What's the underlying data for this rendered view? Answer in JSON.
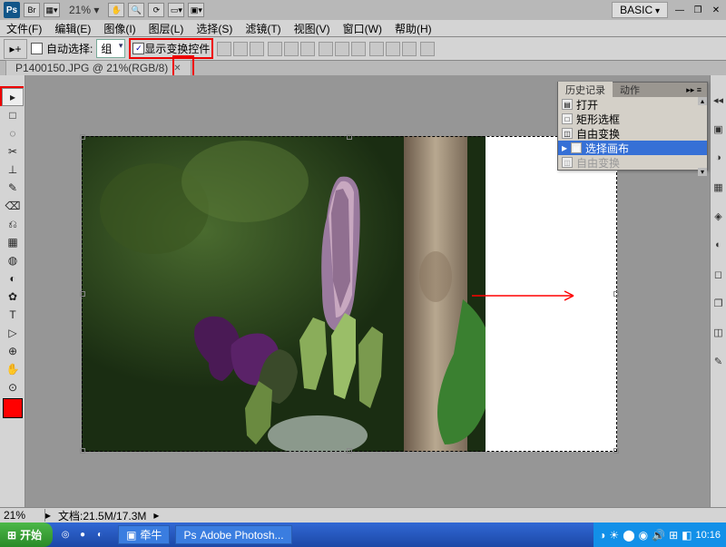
{
  "topbar": {
    "ps": "Ps",
    "br": "Br",
    "zoom": "21%",
    "workspace": "BASIC"
  },
  "menu": [
    "文件(F)",
    "编辑(E)",
    "图像(I)",
    "图层(L)",
    "选择(S)",
    "滤镜(T)",
    "视图(V)",
    "窗口(W)",
    "帮助(H)"
  ],
  "options": {
    "autoselect": "自动选择:",
    "group": "组",
    "transform": "显示变换控件"
  },
  "tab": {
    "title": "P1400150.JPG @ 21%(RGB/8)"
  },
  "tools": [
    "▸",
    "□",
    "◌",
    "✂",
    "⊥",
    "✎",
    "⌫",
    "⎌",
    "▦",
    "◍",
    "◐",
    "✿",
    "T",
    "▷",
    "⊕",
    "✋",
    "⊙"
  ],
  "history": {
    "tabs": [
      "历史记录",
      "动作"
    ],
    "items": [
      {
        "label": "打开",
        "sel": false,
        "dim": false
      },
      {
        "label": "矩形选框",
        "sel": false,
        "dim": false
      },
      {
        "label": "自由变换",
        "sel": false,
        "dim": false
      },
      {
        "label": "选择画布",
        "sel": true,
        "dim": false
      },
      {
        "label": "自由变换",
        "sel": false,
        "dim": true
      }
    ]
  },
  "status": {
    "zoom": "21%",
    "doc": "文档:21.5M/17.3M"
  },
  "taskbar": {
    "start": "开始",
    "apps": [
      "牵牛",
      "Adobe Photosh..."
    ],
    "clock": "10:16"
  }
}
